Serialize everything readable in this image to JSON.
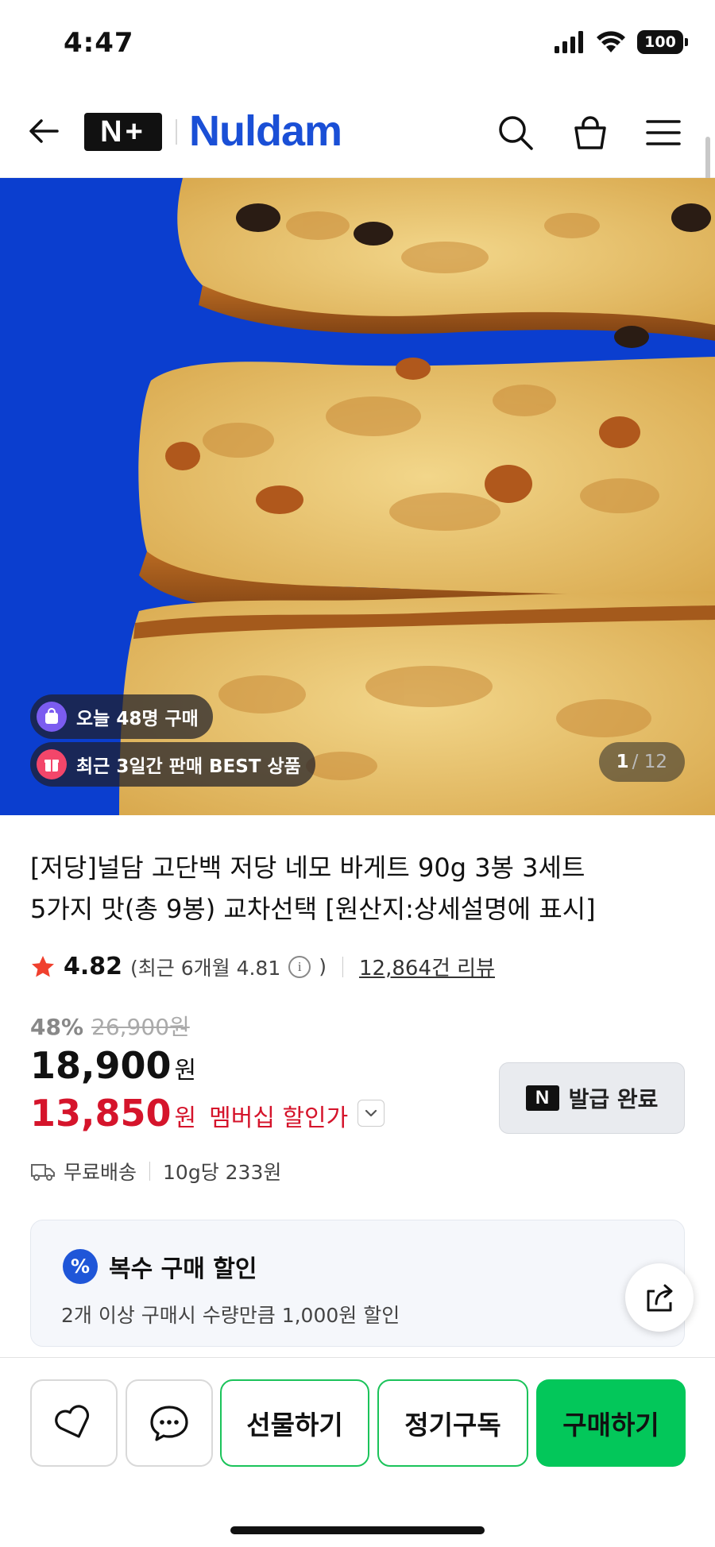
{
  "status_bar": {
    "time": "4:47",
    "battery": "100"
  },
  "header": {
    "badge_text": "N+",
    "brand": "Nuldam"
  },
  "hero": {
    "chip_today": "오늘 48명 구매",
    "chip_best": "최근 3일간 판매 BEST 상품",
    "page_current": "1",
    "page_total": "/ 12",
    "background_color": "#0b3ecf"
  },
  "product": {
    "title_line1": "[저당]널담 고단백 저당 네모 바게트 90g 3봉 3세트",
    "title_line2": "5가지 맛(총 9봉) 교차선택 [원산지:상세설명에 표시]",
    "rating": "4.82",
    "rating_recent": "(최근 6개월 4.81",
    "rating_recent_close": ")",
    "review_count": "12,864건 리뷰",
    "discount_rate": "48%",
    "original_price": "26,900원",
    "price": "18,900",
    "price_unit": "원",
    "member_price": "13,850",
    "member_price_unit": "원",
    "member_label": "멤버십 할인가",
    "coupon_badge": "N",
    "coupon_label": "발급 완료",
    "shipping": "무료배송",
    "unit_price": "10g당 233원"
  },
  "promo": {
    "badge": "%",
    "title": "복수 구매 할인",
    "description": "2개 이상 구매시 수량만큼 1,000원 할인"
  },
  "bottom_bar": {
    "gift_label": "선물하기",
    "subscribe_label": "정기구독",
    "buy_label": "구매하기"
  },
  "colors": {
    "brand": "#1a4fd6",
    "member_price": "#d5142b",
    "buy_button": "#03c75a",
    "promo_badge": "#1f56d8"
  }
}
